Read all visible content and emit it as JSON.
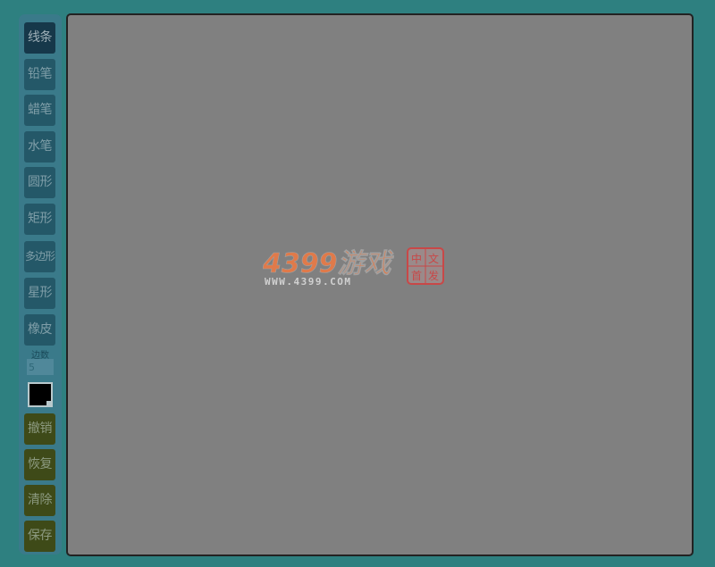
{
  "tools": [
    {
      "label": "线条",
      "active": true
    },
    {
      "label": "铅笔",
      "active": false
    },
    {
      "label": "蜡笔",
      "active": false
    },
    {
      "label": "水笔",
      "active": false
    },
    {
      "label": "圆形",
      "active": false
    },
    {
      "label": "矩形",
      "active": false
    },
    {
      "label": "多边形",
      "active": false
    },
    {
      "label": "星形",
      "active": false
    },
    {
      "label": "橡皮",
      "active": false
    }
  ],
  "sides": {
    "label": "边数",
    "value": "5"
  },
  "color": {
    "current": "#000000"
  },
  "actions": {
    "undo": "撤销",
    "redo": "恢复",
    "clear": "清除",
    "save": "保存"
  },
  "watermark": {
    "brand": "4399游戏",
    "url": "WWW.4399.COM",
    "seal": [
      "中",
      "文",
      "首",
      "发"
    ]
  },
  "colors": {
    "background": "#2e8080",
    "canvas": "#808080",
    "brand_orange": "#e07a4a",
    "seal_red": "#c84848"
  }
}
